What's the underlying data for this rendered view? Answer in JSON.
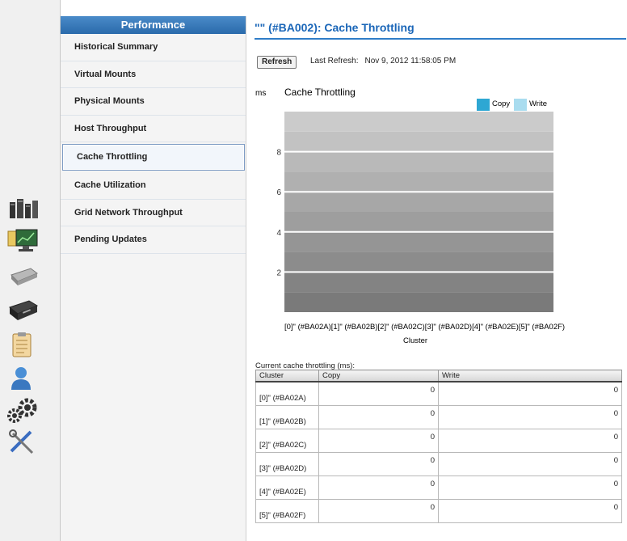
{
  "rail": {
    "icons": [
      "servers-icon",
      "monitor-chart-icon",
      "drive-icon",
      "tape-drive-icon",
      "clipboard-icon",
      "user-icon",
      "gears-icon",
      "tools-icon"
    ]
  },
  "nav": {
    "header": "Performance",
    "items": [
      {
        "label": "Historical Summary",
        "active": false
      },
      {
        "label": "Virtual Mounts",
        "active": false
      },
      {
        "label": "Physical Mounts",
        "active": false
      },
      {
        "label": "Host Throughput",
        "active": false
      },
      {
        "label": "Cache Throttling",
        "active": true
      },
      {
        "label": "Cache Utilization",
        "active": false
      },
      {
        "label": "Grid Network Throughput",
        "active": false
      },
      {
        "label": "Pending Updates",
        "active": false
      }
    ]
  },
  "page": {
    "title": "\"\" (#BA002): Cache Throttling",
    "refresh_label": "Refresh",
    "last_refresh_label": "Last Refresh:",
    "last_refresh_value": "Nov 9, 2012 11:58:05 PM"
  },
  "chart_data": {
    "type": "bar",
    "title": "Cache Throttling",
    "ylabel": "ms",
    "xlabel": "Cluster",
    "categories": [
      "[0]\" (#BA02A)",
      "[1]\" (#BA02B)",
      "[2]\" (#BA02C)",
      "[3]\" (#BA02D)",
      "[4]\" (#BA02E)",
      "[5]\" (#BA02F)"
    ],
    "categories_text": "[0]\" (#BA02A)[1]\" (#BA02B)[2]\" (#BA02C)[3]\" (#BA02D)[4]\" (#BA02E)[5]\" (#BA02F)",
    "series": [
      {
        "name": "Copy",
        "values": [
          0,
          0,
          0,
          0,
          0,
          0
        ],
        "color": "#2ea7d3"
      },
      {
        "name": "Write",
        "values": [
          0,
          0,
          0,
          0,
          0,
          0
        ],
        "color": "#a9dcef"
      }
    ],
    "yticks": [
      2,
      4,
      6,
      8
    ],
    "ylim": [
      0,
      10
    ],
    "legend": "top-right",
    "grid": true
  },
  "table": {
    "caption": "Current cache throttling (ms):",
    "headers": [
      "Cluster",
      "Copy",
      "Write"
    ],
    "rows": [
      {
        "cluster": "[0]\" (#BA02A)",
        "copy": "0",
        "write": "0"
      },
      {
        "cluster": "[1]\" (#BA02B)",
        "copy": "0",
        "write": "0"
      },
      {
        "cluster": "[2]\" (#BA02C)",
        "copy": "0",
        "write": "0"
      },
      {
        "cluster": "[3]\" (#BA02D)",
        "copy": "0",
        "write": "0"
      },
      {
        "cluster": "[4]\" (#BA02E)",
        "copy": "0",
        "write": "0"
      },
      {
        "cluster": "[5]\" (#BA02F)",
        "copy": "0",
        "write": "0"
      }
    ]
  }
}
